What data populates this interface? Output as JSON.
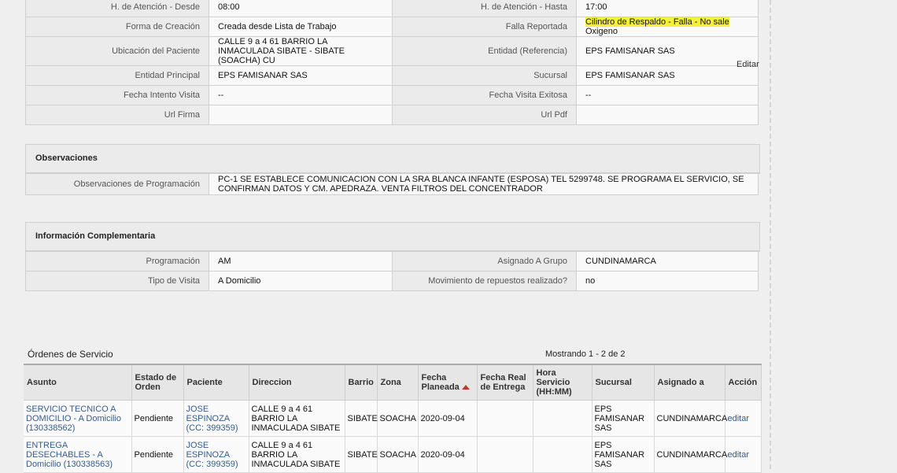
{
  "detail": {
    "rows": [
      {
        "l1": "H. de Atención - Desde",
        "v1": "08:00",
        "l2": "H. de Atención - Hasta",
        "v2": "17:00"
      },
      {
        "l1": "Forma de Creación",
        "v1": "Creada desde Lista de Trabajo",
        "l2": "Falla Reportada",
        "v2_hl": "Cilindro de Respaldo - Falla - No sale",
        "v2_rest": "Oxigeno"
      },
      {
        "l1": "Ubicación del Paciente",
        "v1": "CALLE 9 a 4 61 BARRIO LA INMACULADA SIBATE - SIBATE (SOACHA) CU",
        "l2": "Entidad (Referencia)",
        "v2": "EPS FAMISANAR SAS"
      },
      {
        "l1": "Entidad Principal",
        "v1": "EPS FAMISANAR SAS",
        "l2": "Sucursal",
        "v2": "EPS FAMISANAR SAS"
      },
      {
        "l1": "Fecha Intento Visita",
        "v1": "--",
        "l2": "Fecha Visita Exitosa",
        "v2": "--"
      },
      {
        "l1": "Url Firma",
        "v1": "",
        "l2": "Url Pdf",
        "v2": ""
      }
    ],
    "edit_label": "Editar"
  },
  "observaciones": {
    "title": "Observaciones",
    "label": "Observaciones de Programación",
    "text": "PC-1 SE ESTABLECE COMUNICACION CON LA SRA BLANCA INFANTE (ESPOSA) TEL 5299748. SE PROGRAMA EL SERVICIO, SE CONFIRMAN DATOS Y CM. APEDRAZA. VENTA FILTROS DEL CONCENTRADOR"
  },
  "complementaria": {
    "title": "Información Complementaria",
    "rows": [
      {
        "l1": "Programación",
        "v1": "AM",
        "l2": "Asignado A Grupo",
        "v2": "CUNDINAMARCA"
      },
      {
        "l1": "Tipo de Visita",
        "v1": "A Domicilio",
        "l2": "Movimiento de repuestos realizado?",
        "v2": "no"
      }
    ]
  },
  "orders": {
    "title": "Órdenes de Servicio",
    "showing": "Mostrando 1 - 2 de 2",
    "columns": [
      "Asunto",
      "Estado de Orden",
      "Paciente",
      "Direccion",
      "Barrio",
      "Zona",
      "Fecha Planeada",
      "Fecha Real de Entrega",
      "Hora Servicio (HH:MM)",
      "Sucursal",
      "Asignado a",
      "Acción"
    ],
    "rows": [
      {
        "asunto": "SERVICIO TECNICO A DOMICILIO - A Domicilio (130338562)",
        "estado": "Pendiente",
        "paciente": "JOSE ESPINOZA (CC: 399359)",
        "direccion": "CALLE 9 a 4 61 BARRIO LA INMACULADA SIBATE",
        "barrio": "SIBATE",
        "zona": "SOACHA",
        "fecha": "2020-09-04",
        "fecha_real": "",
        "hora": "",
        "sucursal": "EPS FAMISANAR SAS",
        "asignado": "CUNDINAMARCA",
        "accion": "editar"
      },
      {
        "asunto": "ENTREGA DESECHABLES - A Domicilio (130338563)",
        "estado": "Pendiente",
        "paciente": "JOSE ESPINOZA (CC: 399359)",
        "direccion": "CALLE 9 a 4 61 BARRIO LA INMACULADA SIBATE",
        "barrio": "SIBATE",
        "zona": "SOACHA",
        "fecha": "2020-09-04",
        "fecha_real": "",
        "hora": "",
        "sucursal": "EPS FAMISANAR SAS",
        "asignado": "CUNDINAMARCA",
        "accion": "editar"
      }
    ]
  }
}
